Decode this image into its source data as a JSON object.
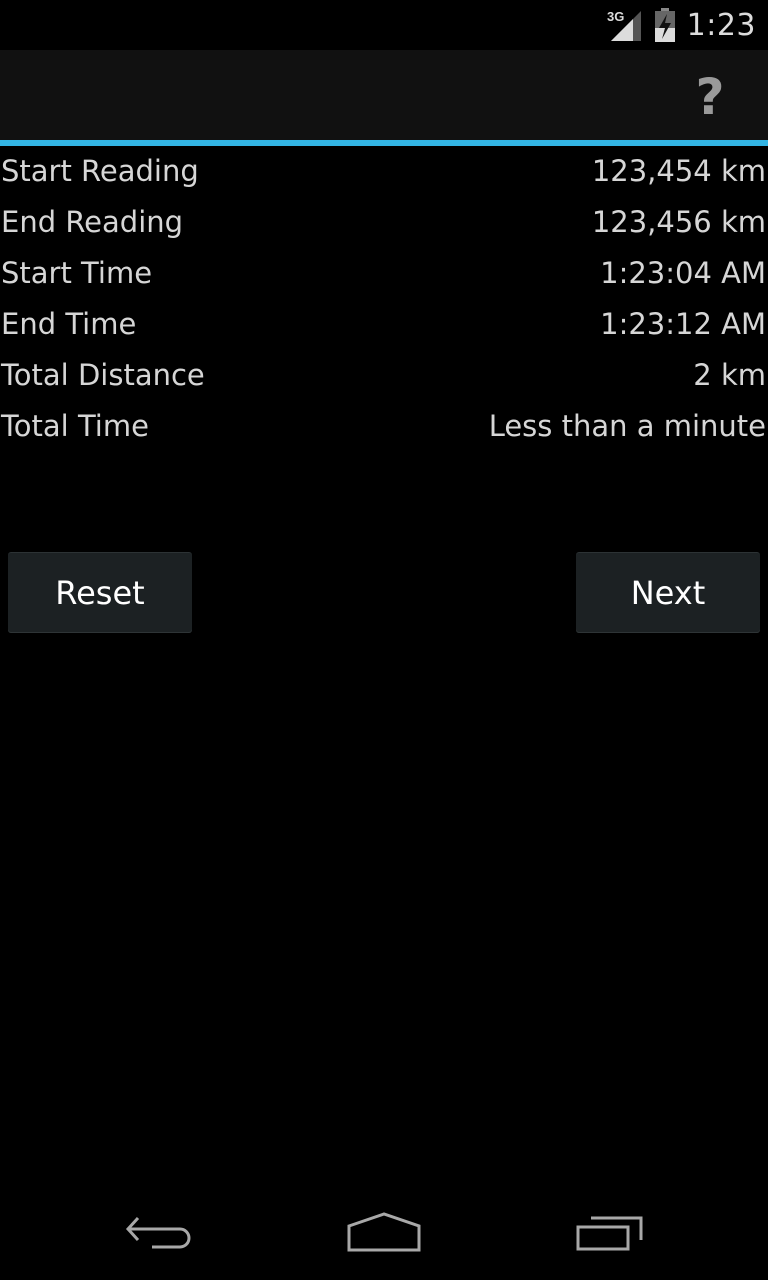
{
  "status_bar": {
    "network_label": "3G",
    "time": "1:23",
    "icons": [
      "signal-icon",
      "battery-charging-icon"
    ]
  },
  "action_bar": {
    "help_label": "?",
    "accent_color": "#33b5e5"
  },
  "details": [
    {
      "label": "Start Reading",
      "value": "123,454 km"
    },
    {
      "label": "End Reading",
      "value": "123,456 km"
    },
    {
      "label": "Start Time",
      "value": "1:23:04 AM"
    },
    {
      "label": "End Time",
      "value": "1:23:12 AM"
    },
    {
      "label": "Total Distance",
      "value": "2 km"
    },
    {
      "label": "Total Time",
      "value": "Less than a minute"
    }
  ],
  "buttons": {
    "reset_label": "Reset",
    "next_label": "Next"
  },
  "nav_bar": {
    "icons": [
      "back-icon",
      "home-icon",
      "recent-apps-icon"
    ]
  }
}
